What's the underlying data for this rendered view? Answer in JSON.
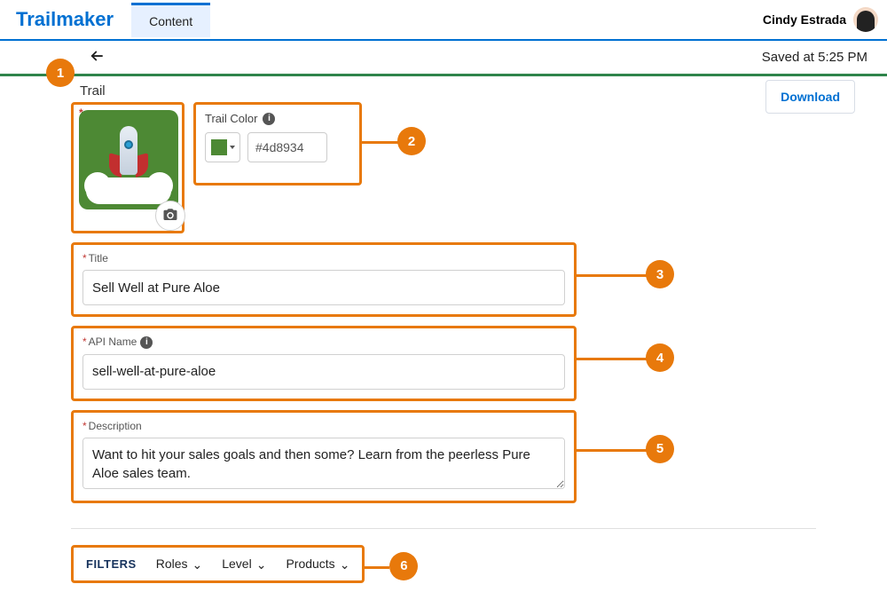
{
  "header": {
    "logo_text": "Trailmaker",
    "tab_label": "Content",
    "user_name": "Cindy Estrada"
  },
  "subheader": {
    "saved_text": "Saved at 5:25 PM"
  },
  "trail": {
    "section_label": "Trail",
    "download_label": "Download",
    "color": {
      "label": "Trail Color",
      "hex": "#4d8934"
    },
    "title": {
      "label": "Title",
      "value": "Sell Well at Pure Aloe"
    },
    "api_name": {
      "label": "API Name",
      "value": "sell-well-at-pure-aloe"
    },
    "description": {
      "label": "Description",
      "value": "Want to hit your sales goals and then some? Learn from the peerless Pure Aloe sales team."
    }
  },
  "filters": {
    "title": "FILTERS",
    "items": [
      "Roles",
      "Level",
      "Products"
    ]
  },
  "callouts": {
    "c1": "1",
    "c2": "2",
    "c3": "3",
    "c4": "4",
    "c5": "5",
    "c6": "6"
  }
}
